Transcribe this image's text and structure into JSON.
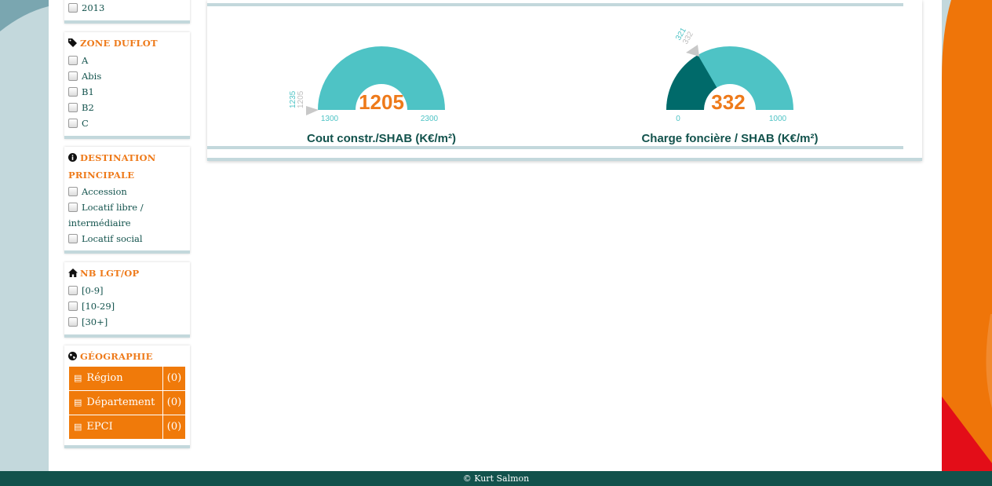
{
  "filters": {
    "year": {
      "options": [
        "2013"
      ]
    },
    "zone": {
      "title": "ZONE DUFLOT",
      "options": [
        "A",
        "Abis",
        "B1",
        "B2",
        "C"
      ]
    },
    "destination": {
      "title": "DESTINATION PRINCIPALE",
      "options": [
        "Accession",
        "Locatif libre / intermédiaire",
        "Locatif social"
      ]
    },
    "nb": {
      "title": "NB LGT/OP",
      "options": [
        "[0-9]",
        "[10-29]",
        "[30+]"
      ]
    },
    "geo": {
      "title": "GÉOGRAPHIE",
      "buttons": [
        {
          "label": "Région",
          "count": "(0)"
        },
        {
          "label": "Département",
          "count": "(0)"
        },
        {
          "label": "EPCI",
          "count": "(0)"
        }
      ]
    }
  },
  "gauges": [
    {
      "title": "Cout constr./SHAB (K€/m²)",
      "value": "1205",
      "min": "1300",
      "max": "2300",
      "marker1": "1235",
      "marker2": "1205",
      "fill_fraction": 1.0
    },
    {
      "title": "Charge foncière / SHAB (K€/m²)",
      "value": "332",
      "min": "0",
      "max": "1000",
      "marker1": "321",
      "marker2": "332",
      "fill_fraction": 0.332
    }
  ],
  "colors": {
    "accent": "#ee7a1a",
    "teal": "#4ec3c5",
    "dark_teal": "#006a6a",
    "footer": "#12524c"
  },
  "footer": {
    "text": "© Kurt Salmon"
  }
}
